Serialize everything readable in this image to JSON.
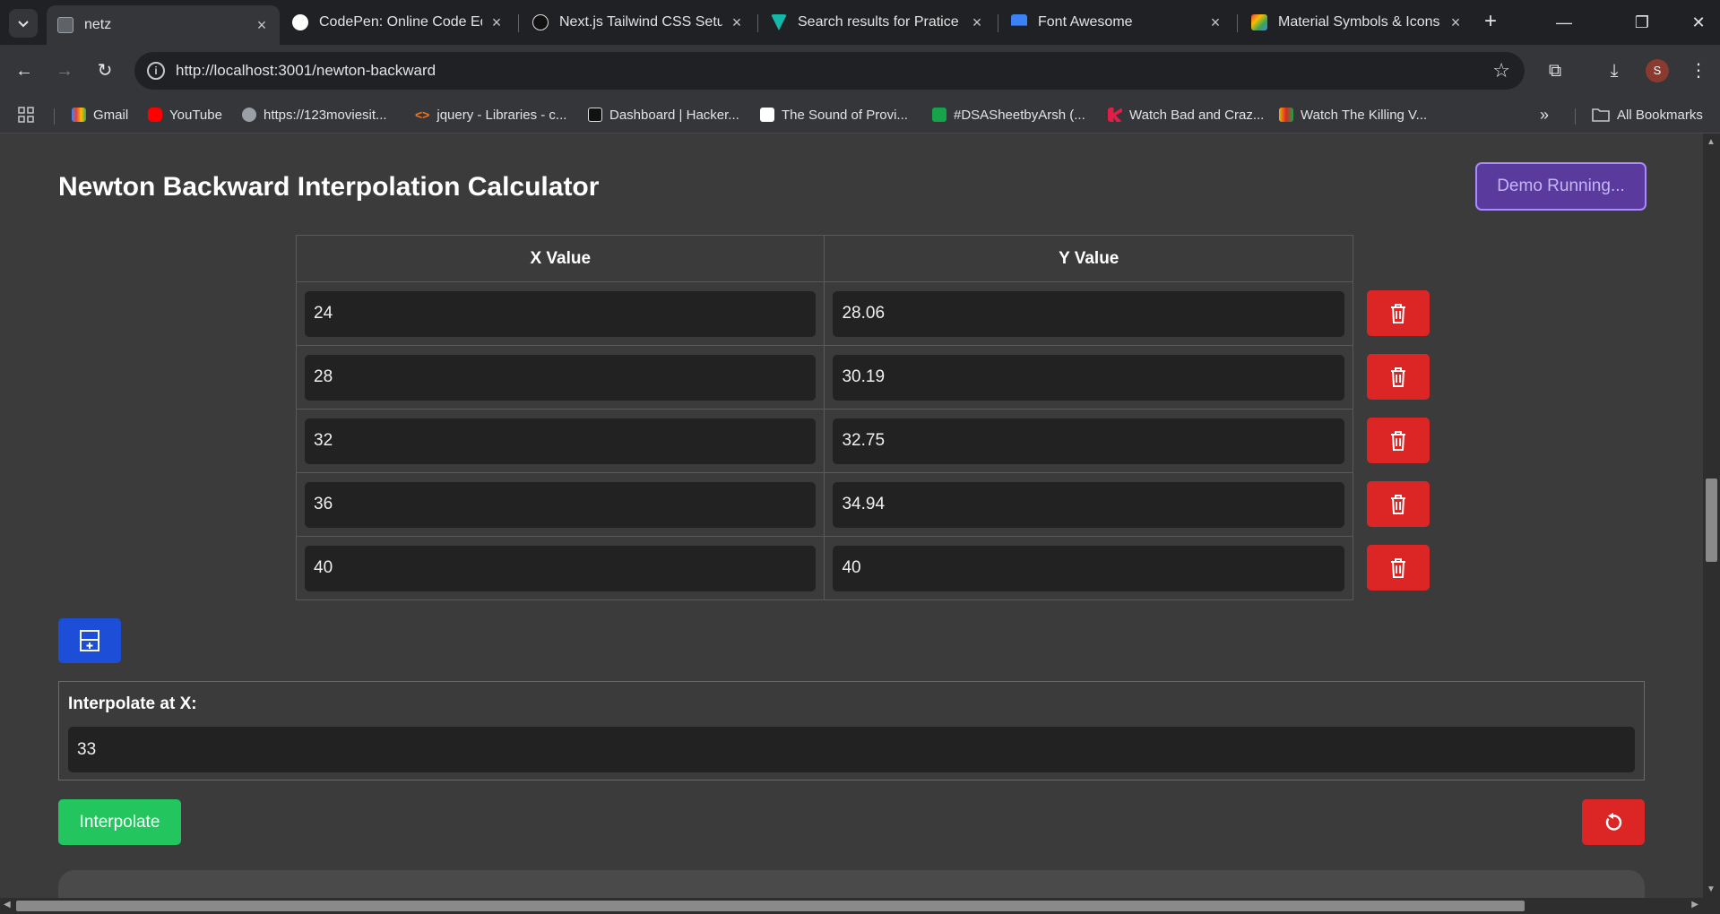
{
  "browser": {
    "tabs": [
      {
        "title": "netz",
        "active": true
      },
      {
        "title": "CodePen: Online Code Edit",
        "active": false
      },
      {
        "title": "Next.js Tailwind CSS Setup",
        "active": false
      },
      {
        "title": "Search results for Pratice -",
        "active": false
      },
      {
        "title": "Font Awesome",
        "active": false
      },
      {
        "title": "Material Symbols & Icons -",
        "active": false
      }
    ],
    "url": "http://localhost:3001/newton-backward",
    "avatar_letter": "S",
    "bookmarks": [
      "Gmail",
      "YouTube",
      "https://123moviesit...",
      "jquery - Libraries - c...",
      "Dashboard | Hacker...",
      "The Sound of Provi...",
      "#DSASheetbyArsh (...",
      "Watch Bad and Craz...",
      "Watch The Killing V..."
    ],
    "all_bookmarks_label": "All Bookmarks"
  },
  "app": {
    "title": "Newton Backward Interpolation Calculator",
    "demo_button_label": "Demo Running...",
    "table": {
      "headers": [
        "X Value",
        "Y Value"
      ],
      "rows": [
        {
          "x": "24",
          "y": "28.06"
        },
        {
          "x": "28",
          "y": "30.19"
        },
        {
          "x": "32",
          "y": "32.75"
        },
        {
          "x": "36",
          "y": "34.94"
        },
        {
          "x": "40",
          "y": "40"
        }
      ]
    },
    "interpolate_label": "Interpolate at X:",
    "interpolate_value": "33",
    "interpolate_button_label": "Interpolate"
  },
  "colors": {
    "delete_button": "#dc2626",
    "add_row_button": "#1d4ed8",
    "interpolate_button": "#22c55e",
    "demo_button": "#5b3a9e"
  }
}
